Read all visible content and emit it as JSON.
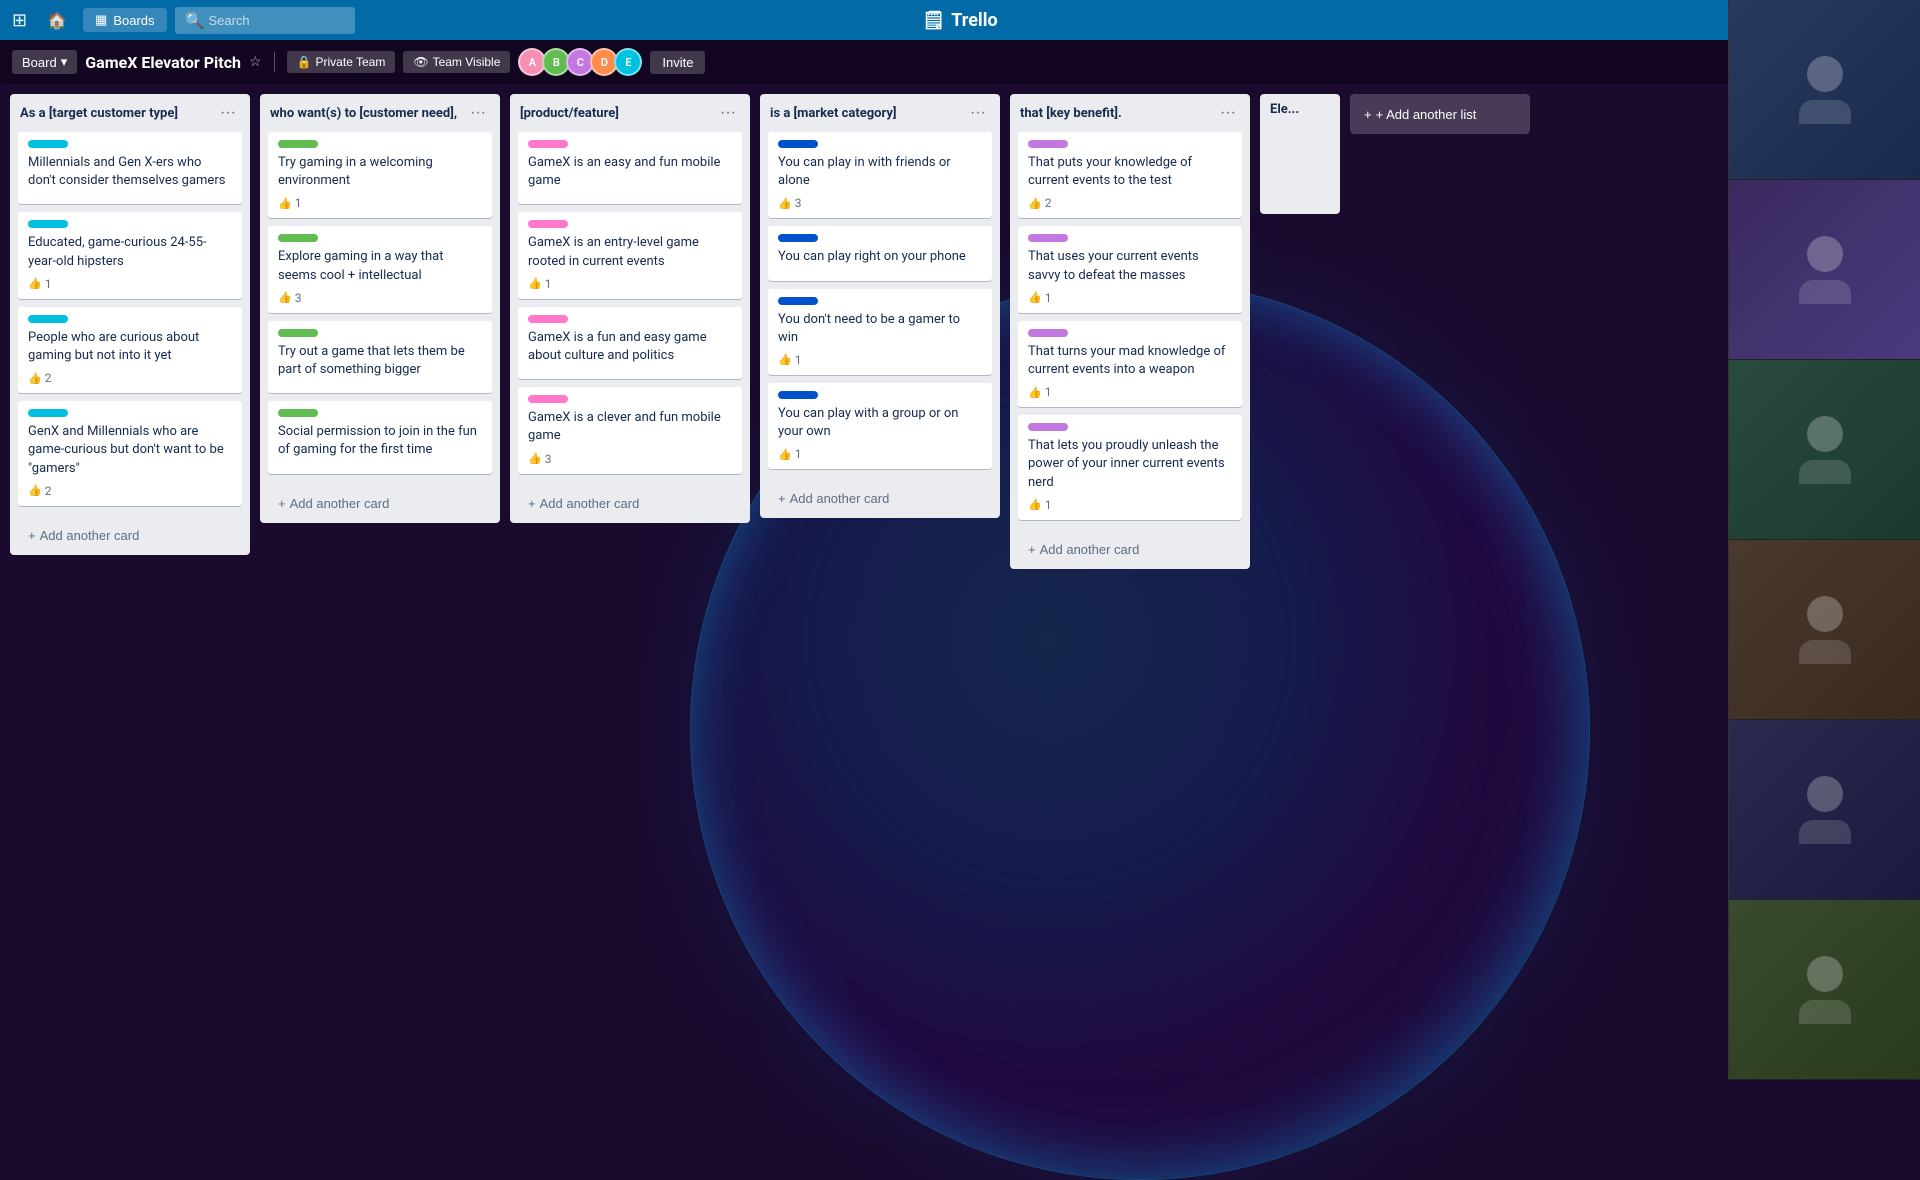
{
  "app": {
    "name": "Trello",
    "logo_icon": "🗒"
  },
  "topbar": {
    "grid_icon": "⊞",
    "home_icon": "🏠",
    "boards_label": "Boards",
    "search_placeholder": "Search",
    "search_icon": "🔍"
  },
  "board_toolbar": {
    "menu_label": "Board",
    "menu_icon": "▾",
    "title": "GameX Elevator Pitch",
    "star_icon": "☆",
    "privacy_icon": "🔒",
    "privacy_label": "Private Team",
    "visibility_icon": "👁",
    "visibility_label": "Team Visible",
    "invite_label": "Invite",
    "avatars": [
      {
        "color": "#F78EB4",
        "initials": "A"
      },
      {
        "color": "#61BD4F",
        "initials": "B"
      },
      {
        "color": "#C377E0",
        "initials": "C"
      },
      {
        "color": "#FF8B4D",
        "initials": "D"
      },
      {
        "color": "#00C2E0",
        "initials": "E"
      }
    ]
  },
  "columns": [
    {
      "id": "col1",
      "title": "As a [target customer type]",
      "cards": [
        {
          "label_color": "cyan",
          "text": "Millennials and Gen X-ers who don't consider themselves gamers",
          "votes": null
        },
        {
          "label_color": "cyan",
          "text": "Educated, game-curious 24-55-year-old hipsters",
          "votes": 1
        },
        {
          "label_color": "cyan",
          "text": "People who are curious about gaming but not into it yet",
          "votes": 2
        },
        {
          "label_color": "cyan",
          "text": "GenX and Millennials who are game-curious but don't want to be \"gamers\"",
          "votes": 2
        }
      ],
      "add_label": "+ Add another card"
    },
    {
      "id": "col2",
      "title": "who want(s) to [customer need],",
      "cards": [
        {
          "label_color": "green",
          "text": "Try gaming in a welcoming environment",
          "votes": 1
        },
        {
          "label_color": "green",
          "text": "Explore gaming in a way that seems cool + intellectual",
          "votes": 3
        },
        {
          "label_color": "green",
          "text": "Try out a game that lets them be part of something bigger",
          "votes": null
        },
        {
          "label_color": "green",
          "text": "Social permission to join in the fun of gaming for the first time",
          "votes": null
        }
      ],
      "add_label": "+ Add another card"
    },
    {
      "id": "col3",
      "title": "[product/feature]",
      "cards": [
        {
          "label_color": "pink",
          "text": "GameX is an easy and fun mobile game",
          "votes": null
        },
        {
          "label_color": "pink",
          "text": "GameX is an entry-level game rooted in current events",
          "votes": 1
        },
        {
          "label_color": "pink",
          "text": "GameX is a fun and easy game about culture and politics",
          "votes": null
        },
        {
          "label_color": "pink",
          "text": "GameX is a clever and fun mobile game",
          "votes": 3
        }
      ],
      "add_label": "+ Add another card"
    },
    {
      "id": "col4",
      "title": "is a [market category]",
      "cards": [
        {
          "label_color": "dark-blue",
          "text": "You can play in with friends or alone",
          "votes": 3
        },
        {
          "label_color": "dark-blue",
          "text": "You can play right on your phone",
          "votes": null
        },
        {
          "label_color": "dark-blue",
          "text": "You don't need to be a gamer to win",
          "votes": 1
        },
        {
          "label_color": "dark-blue",
          "text": "You can play with a group or on your own",
          "votes": 1
        }
      ],
      "add_label": "+ Add another card"
    },
    {
      "id": "col5",
      "title": "that [key benefit].",
      "cards": [
        {
          "label_color": "purple",
          "text": "That puts your knowledge of current events to the test",
          "votes": 2
        },
        {
          "label_color": "purple",
          "text": "That uses your current events savvy to defeat the masses",
          "votes": 1
        },
        {
          "label_color": "purple",
          "text": "That turns your mad knowledge of current events into a weapon",
          "votes": 1
        },
        {
          "label_color": "purple",
          "text": "That lets you proudly unleash the power of your inner current events nerd",
          "votes": 1
        }
      ],
      "add_label": "+ Add another card"
    },
    {
      "id": "col6",
      "title": "Ele...",
      "cards": [],
      "add_label": ""
    }
  ],
  "video_panel": {
    "participants": [
      {
        "bg_class": "vc1",
        "has_person": true
      },
      {
        "bg_class": "vc2",
        "has_person": true
      },
      {
        "bg_class": "vc3",
        "has_person": true
      },
      {
        "bg_class": "vc4",
        "has_person": true
      },
      {
        "bg_class": "vc5",
        "has_person": true
      },
      {
        "bg_class": "vc6",
        "has_person": true
      }
    ]
  },
  "add_column_label": "+ Add another list"
}
